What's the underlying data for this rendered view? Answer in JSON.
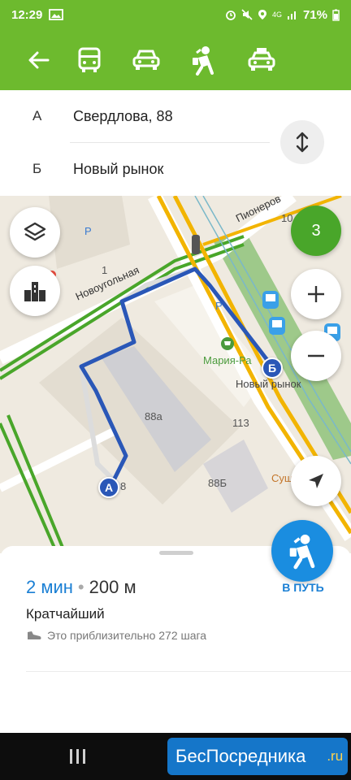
{
  "status_bar": {
    "time": "12:29",
    "network": "4G",
    "battery": "71%"
  },
  "toolbar": {
    "back_icon": "arrow-left-icon",
    "modes": [
      "bus-icon",
      "car-icon",
      "pedestrian-icon",
      "taxi-icon"
    ]
  },
  "route": {
    "from_letter": "А",
    "from_text": "Свердлова, 88",
    "to_letter": "Б",
    "to_text": "Новый рынок",
    "swap_icon": "swap-vertical-icon"
  },
  "map": {
    "streets": [
      "Новоугольная",
      "Пионеров"
    ],
    "place_labels": [
      "Мария-Ра",
      "Новый рынок",
      "88а",
      "88Б",
      "113",
      "Суш",
      "10",
      "1",
      "8",
      "Р",
      "Р"
    ],
    "pin_a": "А",
    "pin_b": "Б",
    "traffic_level": "3",
    "controls": [
      "layers-icon",
      "buildings-icon",
      "zoom-in-icon",
      "zoom-out-icon",
      "locate-icon"
    ],
    "colors": {
      "route": "#2a57b7",
      "road_green": "#49a62a",
      "road_yellow": "#f2b400",
      "parking": "#9ec98a"
    }
  },
  "summary": {
    "time": "2 мин",
    "separator": "•",
    "distance": "200 м",
    "route_type": "Кратчайший",
    "steps_text": "Это приблизительно 272 шага",
    "go_label": "В ПУТЬ",
    "go_icon": "pedestrian-icon"
  },
  "watermark": {
    "text": "БесПосредника",
    "tld": ".ru"
  }
}
